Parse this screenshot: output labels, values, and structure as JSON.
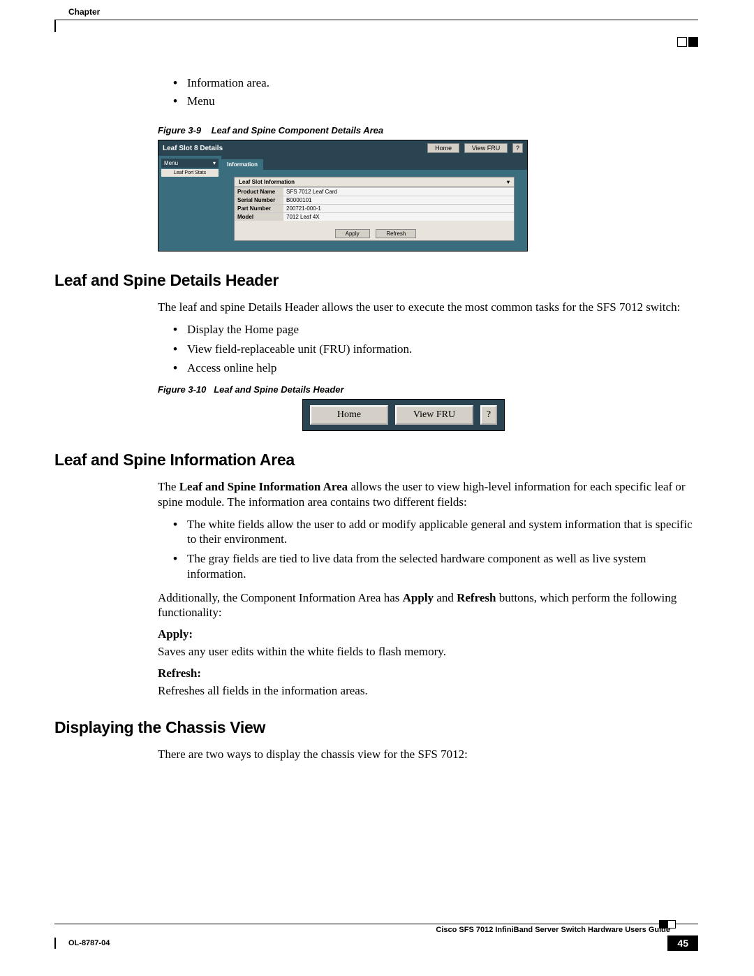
{
  "header": {
    "chapter_label": "Chapter"
  },
  "intro_bullets": [
    "Information area.",
    "Menu"
  ],
  "fig9": {
    "caption_prefix": "Figure 3-9",
    "caption_text": "Leaf and Spine Component Details Area",
    "title": "Leaf Slot 8 Details",
    "btn_home": "Home",
    "btn_viewfru": "View FRU",
    "btn_help": "?",
    "side_menu_label": "Menu",
    "side_menu_item": "Leaf Port Stats",
    "tab_label": "Information",
    "info_title": "Leaf Slot Information",
    "rows": [
      {
        "k": "Product Name",
        "v": "SFS 7012 Leaf Card"
      },
      {
        "k": "Serial Number",
        "v": "B0000101"
      },
      {
        "k": "Part Number",
        "v": "200721-000-1"
      },
      {
        "k": "Model",
        "v": "7012 Leaf 4X"
      }
    ],
    "btn_apply": "Apply",
    "btn_refresh": "Refresh"
  },
  "sec1": {
    "heading": "Leaf and Spine Details Header",
    "para": "The leaf and spine Details Header allows the user to execute the most common tasks for the SFS 7012 switch:",
    "bullets": [
      "Display the Home page",
      "View field-replaceable unit (FRU) information.",
      "Access online help"
    ]
  },
  "fig10": {
    "caption_prefix": "Figure 3-10",
    "caption_text": "Leaf and Spine Details Header",
    "btn_home": "Home",
    "btn_viewfru": "View FRU",
    "btn_help": "?"
  },
  "sec2": {
    "heading": "Leaf and Spine Information Area",
    "para1_pre": "The ",
    "para1_bold": "Leaf and Spine Information Area",
    "para1_post": " allows the user to view high-level information for each specific leaf or spine module. The information area contains two different fields:",
    "bullets": [
      "The white fields allow the user to add or modify applicable general and system information that is specific to their environment.",
      "The gray fields are tied to live data from the selected hardware component as well as live system information."
    ],
    "para2_pre": "Additionally, the Component Information Area has ",
    "para2_b1": "Apply",
    "para2_mid": " and ",
    "para2_b2": "Refresh",
    "para2_post": " buttons, which perform the following functionality:",
    "apply_label": "Apply:",
    "apply_text": "Saves any user edits within the white fields to flash memory.",
    "refresh_label": "Refresh:",
    "refresh_text": "Refreshes all fields in the information areas."
  },
  "sec3": {
    "heading": "Displaying the Chassis View",
    "para": "There are two ways to display the chassis view for the SFS 7012:"
  },
  "footer": {
    "guide": "Cisco SFS 7012 InfiniBand Server Switch Hardware Users Guide",
    "doc": "OL-8787-04",
    "page": "45"
  }
}
